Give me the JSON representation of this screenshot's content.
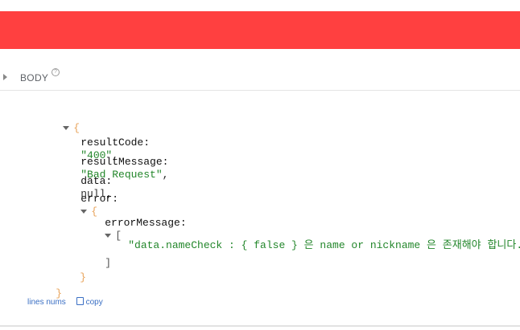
{
  "colors": {
    "banner": "#ff4040",
    "accent_link": "#3a6fc4",
    "string_green": "#22862a",
    "brace_orange": "#e8a35a"
  },
  "section": {
    "label": "BODY",
    "help_icon": "?"
  },
  "json_view": {
    "open_brace": "{",
    "close_brace": "}",
    "fields": {
      "resultCode": {
        "key": "resultCode:",
        "value": "\"400\"",
        "comma": ","
      },
      "resultMessage": {
        "key": "resultMessage:",
        "value": "\"Bad Request\"",
        "comma": ","
      },
      "data": {
        "key": "data:",
        "value": "null",
        "comma": ","
      },
      "error": {
        "key": "error:",
        "open": "{",
        "close": "}"
      },
      "errorMessage": {
        "key": "errorMessage:",
        "open": "[",
        "close": "]",
        "value": "\"data.nameCheck : { false } 은 name or nickname 은 존재해야 합니다.\""
      }
    }
  },
  "footer": {
    "line_numbers": "lines nums",
    "copy": "copy"
  }
}
